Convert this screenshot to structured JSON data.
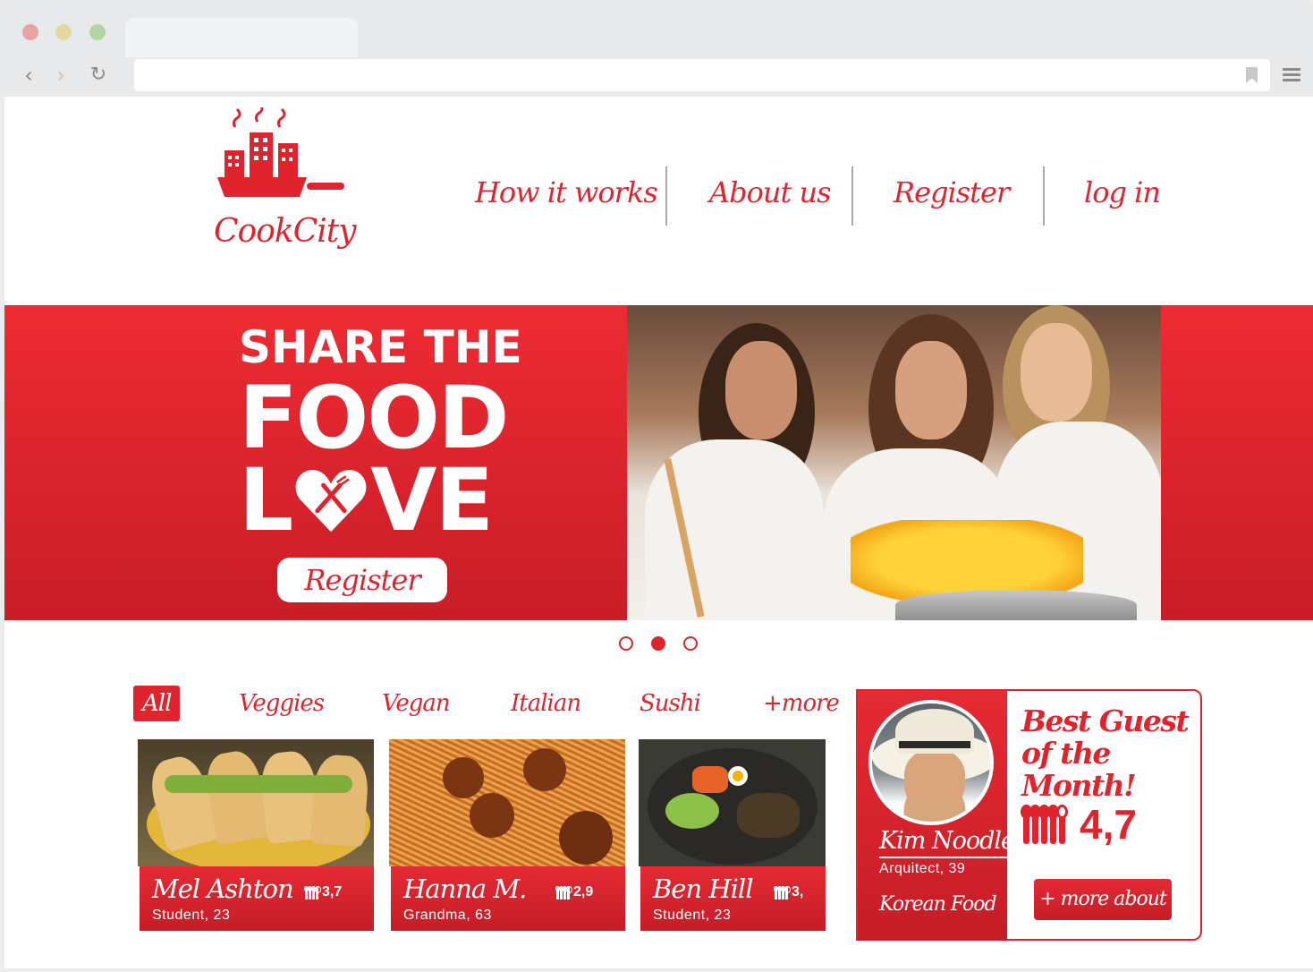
{
  "brand": {
    "logo_text": "CookCity",
    "accent_color": "#e0242d"
  },
  "icons": {
    "back": "chevron-left-icon",
    "forward": "chevron-right-icon",
    "reload": "reload-icon",
    "bookmark": "bookmark-icon",
    "menu": "hamburger-menu-icon"
  },
  "nav": {
    "items": [
      {
        "label": "How it works"
      },
      {
        "label": "About us"
      },
      {
        "label": "Register"
      },
      {
        "label": "log in"
      }
    ]
  },
  "hero": {
    "line1": "SHARE THE",
    "line2": "FOOD",
    "line3_start": "L",
    "line3_end": "VE",
    "register_label": "Register",
    "slides": [
      {
        "active": false
      },
      {
        "active": true
      },
      {
        "active": false
      }
    ]
  },
  "filters": [
    {
      "label": "All",
      "active": true
    },
    {
      "label": "Veggies",
      "active": false
    },
    {
      "label": "Vegan",
      "active": false
    },
    {
      "label": "Italian",
      "active": false
    },
    {
      "label": "Sushi",
      "active": false
    },
    {
      "label": "+more",
      "active": false
    }
  ],
  "cards": [
    {
      "name": "Mel Ashton",
      "subtitle": "Student, 23",
      "rating": "3,7",
      "food": "tacos"
    },
    {
      "name": "Hanna M.",
      "subtitle": "Grandma, 63",
      "rating": "2,9",
      "food": "spaghetti"
    },
    {
      "name": "Ben Hill",
      "subtitle": "Student, 23",
      "rating": "3,",
      "food": "bibimbap"
    }
  ],
  "guest": {
    "name": "Kim Noodle",
    "subtitle": "Arquitect, 39",
    "food": "Korean Food",
    "title_line1": "Best Guest",
    "title_line2": "of the Month!",
    "rating": "4,7",
    "more_label": "+ more about"
  }
}
